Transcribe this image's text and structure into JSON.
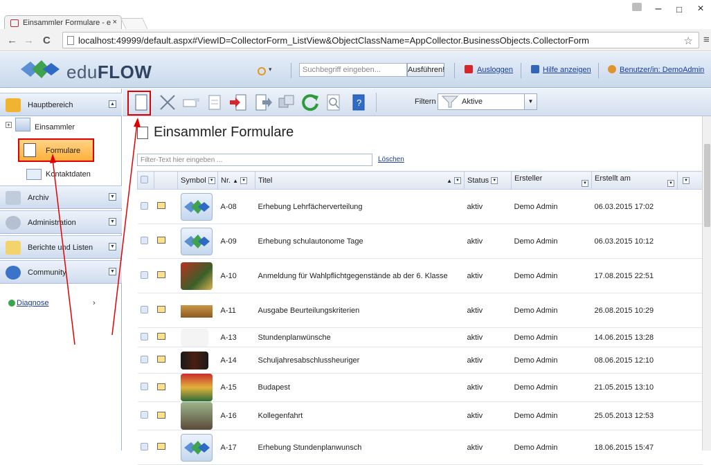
{
  "browser": {
    "tab_title": "Einsammler Formulare - e",
    "tab_close": "×",
    "url": "localhost:49999/default.aspx#ViewID=CollectorForm_ListView&ObjectClassName=AppCollector.BusinessObjects.CollectorForm",
    "back": "←",
    "forward": "→",
    "reload": "C",
    "star": "☆",
    "menu": "≡",
    "minimize": "–",
    "maximize": "□",
    "close": "×"
  },
  "header": {
    "logo_prefix": "edu",
    "logo_suffix": "FLOW",
    "search_placeholder": "Suchbegriff eingeben...",
    "run_button": "Ausführen!",
    "logout": "Ausloggen",
    "help": "Hilfe anzeigen",
    "user": "Benutzer/in: DemoAdmin",
    "caret": "▾"
  },
  "sidebar": {
    "sections": [
      {
        "label": "Hauptbereich",
        "toggle": "▲"
      },
      {
        "label": "Archiv",
        "toggle": "▼"
      },
      {
        "label": "Administration",
        "toggle": "▼"
      },
      {
        "label": "Berichte und Listen",
        "toggle": "▼"
      },
      {
        "label": "Community",
        "toggle": "▼"
      }
    ],
    "tree": {
      "expander": "+",
      "root": "Einsammler",
      "selected": "Formulare",
      "child": "Kontaktdaten"
    },
    "diagnose": "Diagnose",
    "diagnose_arrow": "›"
  },
  "toolbar": {
    "filter_label": "Filtern",
    "filter_value": "Aktive",
    "caret": "▼"
  },
  "content": {
    "title": "Einsammler Formulare",
    "filter_placeholder": "Filter-Text hier eingeben ...",
    "clear": "Löschen",
    "columns": {
      "symbol": "Symbol",
      "nr": "Nr.",
      "sort_asc": "▲",
      "title": "Titel",
      "status": "Status",
      "creator": "Ersteller",
      "created": "Erstellt am",
      "dd": "▼"
    },
    "rows": [
      {
        "nr": "A-08",
        "title": "Erhebung Lehrfächerverteilung",
        "status": "aktiv",
        "creator": "Demo Admin",
        "created": "06.03.2015 17:02",
        "symbol": "eduflow-logo"
      },
      {
        "nr": "A-09",
        "title": "Erhebung schulautonome Tage",
        "status": "aktiv",
        "creator": "Demo Admin",
        "created": "06.03.2015 10:12",
        "symbol": "eduflow-logo"
      },
      {
        "nr": "A-10",
        "title": "Anmeldung für Wahlpflichtgegenstände ab der 6. Klasse",
        "status": "aktiv",
        "creator": "Demo Admin",
        "created": "17.08.2015 22:51",
        "symbol": "books-image"
      },
      {
        "nr": "A-11",
        "title": "Ausgabe Beurteilungskriterien",
        "status": "aktiv",
        "creator": "Demo Admin",
        "created": "26.08.2015 10:29",
        "symbol": "stamp-image"
      },
      {
        "nr": "A-13",
        "title": "Stundenplanwünsche",
        "status": "aktiv",
        "creator": "Demo Admin",
        "created": "14.06.2015 13:28",
        "symbol": "people-image"
      },
      {
        "nr": "A-14",
        "title": "Schuljahresabschlussheuriger",
        "status": "aktiv",
        "creator": "Demo Admin",
        "created": "08.06.2015 12:10",
        "symbol": "party-image"
      },
      {
        "nr": "A-15",
        "title": "Budapest",
        "status": "aktiv",
        "creator": "Demo Admin",
        "created": "21.05.2015 13:10",
        "symbol": "coat-of-arms-image"
      },
      {
        "nr": "A-16",
        "title": "Kollegenfahrt",
        "status": "aktiv",
        "creator": "Demo Admin",
        "created": "25.05.2013 12:53",
        "symbol": "group-photo-image"
      },
      {
        "nr": "A-17",
        "title": "Erhebung Stundenplanwunsch",
        "status": "aktiv",
        "creator": "Demo Admin",
        "created": "18.06.2015 15:47",
        "symbol": "eduflow-logo"
      }
    ]
  }
}
